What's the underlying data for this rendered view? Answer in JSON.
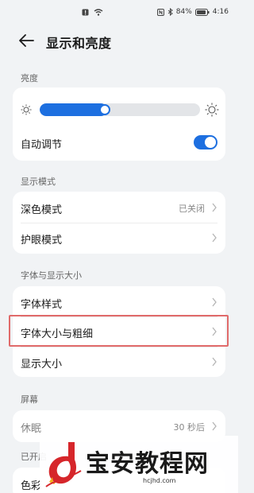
{
  "status_bar": {
    "battery": "84%",
    "time": "4:16"
  },
  "header": {
    "title": "显示和亮度"
  },
  "brightness": {
    "section_label": "亮度",
    "level": 0.42,
    "auto_label": "自动调节",
    "auto_enabled": true
  },
  "display_mode": {
    "section_label": "显示模式",
    "items": [
      {
        "label": "深色模式",
        "value": "已关闭"
      },
      {
        "label": "护眼模式",
        "value": ""
      }
    ]
  },
  "font_size": {
    "section_label": "字体与显示大小",
    "items": [
      {
        "label": "字体样式"
      },
      {
        "label": "字体大小与粗细"
      },
      {
        "label": "显示大小"
      }
    ]
  },
  "screen": {
    "section_label": "屏幕",
    "items": [
      {
        "label": "休眠",
        "value": "30 秒后"
      }
    ]
  },
  "partial": {
    "section_label": "已开启",
    "item_label": "色彩"
  },
  "watermark": {
    "text": "宝安教程网",
    "url": "hcjhd.com"
  },
  "colors": {
    "accent": "#1d6fe0",
    "highlight": "#e06a6a"
  }
}
